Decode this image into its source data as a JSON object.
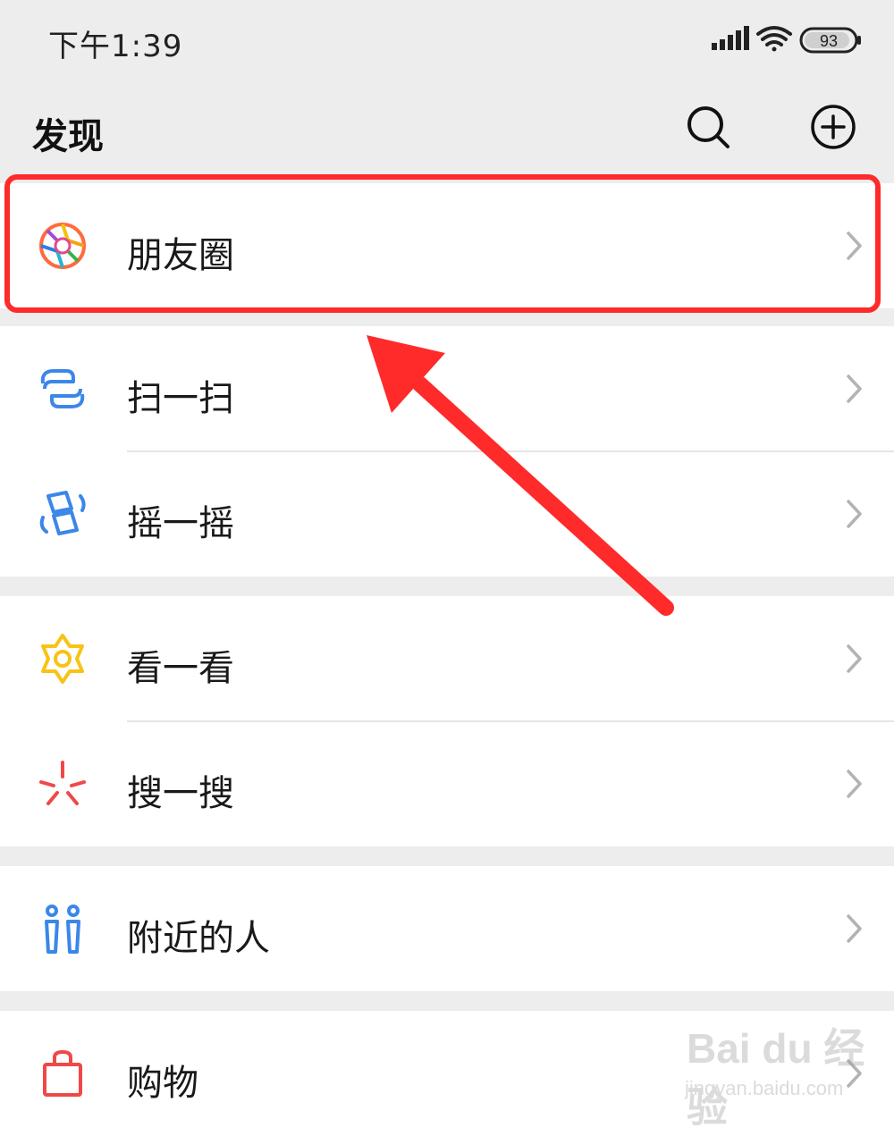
{
  "status_bar": {
    "time": "下午1:39",
    "battery": "93"
  },
  "header": {
    "title": "发现"
  },
  "menu": [
    {
      "label": "朋友圈",
      "icon": "moments-icon"
    },
    {
      "label": "扫一扫",
      "icon": "scan-icon"
    },
    {
      "label": "摇一摇",
      "icon": "shake-icon"
    },
    {
      "label": "看一看",
      "icon": "top-stories-icon"
    },
    {
      "label": "搜一搜",
      "icon": "search-feature-icon"
    },
    {
      "label": "附近的人",
      "icon": "people-nearby-icon"
    },
    {
      "label": "购物",
      "icon": "shopping-bag-icon"
    }
  ],
  "annotation": {
    "color": "#ff2a2a"
  },
  "watermark": {
    "main": "Bai du 经验",
    "sub": "jingyan.baidu.com"
  },
  "colors": {
    "background": "#ededed",
    "card": "#ffffff",
    "accent_blue": "#3b87e8"
  }
}
